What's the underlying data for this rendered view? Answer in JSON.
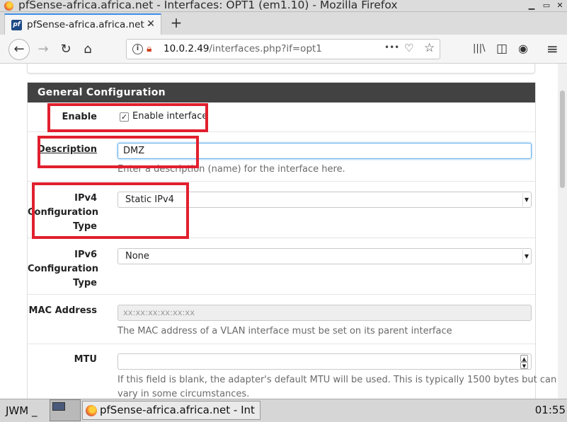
{
  "window": {
    "title": "pfSense-africa.africa.net - Interfaces: OPT1 (em1.10) - Mozilla Firefox",
    "minimize": "▁",
    "maximize": "▭",
    "close": "✕"
  },
  "tab": {
    "favicon": "pf",
    "label": "pfSense-africa.africa.net -",
    "close": "✕",
    "new_tab": "+"
  },
  "nav": {
    "back": "←",
    "forward": "→",
    "reload": "↻",
    "home": "⌂",
    "url_host": "10.0.2.49",
    "url_path": "/interfaces.php?if=opt1",
    "more": "•••",
    "pocket": "♡",
    "bookmark": "☆",
    "library": "|||\\",
    "sidebar": "◫",
    "account": "◉",
    "menu": "≡"
  },
  "panel": {
    "heading": "General Configuration"
  },
  "form": {
    "enable": {
      "label": "Enable",
      "checkbox_label": "Enable interface",
      "checked": true,
      "check_mark": "✓"
    },
    "description": {
      "label": "Description",
      "value": "DMZ",
      "help": "Enter a description (name) for the interface here."
    },
    "ipv4": {
      "label_line1": "IPv4",
      "label_line2": "Configuration",
      "label_line3": "Type",
      "selected": "Static IPv4"
    },
    "ipv6": {
      "label_line1": "IPv6",
      "label_line2": "Configuration",
      "label_line3": "Type",
      "selected": "None"
    },
    "mac": {
      "label": "MAC Address",
      "placeholder": "xx:xx:xx:xx:xx:xx",
      "help": "The MAC address of a VLAN interface must be set on its parent interface"
    },
    "mtu": {
      "label": "MTU",
      "value": "",
      "help_line1": "If this field is blank, the adapter's default MTU will be used. This is typically 1500 bytes but can",
      "help_line2": "vary in some circumstances."
    }
  },
  "taskbar": {
    "wm": "JWM",
    "wm_suffix": "_",
    "task_label": "pfSense-africa.africa.net - Int",
    "clock": "01:55"
  },
  "colors": {
    "highlight_box": "#e1202e",
    "panel_heading_bg": "#424242",
    "focus_ring": "#66afe9"
  }
}
